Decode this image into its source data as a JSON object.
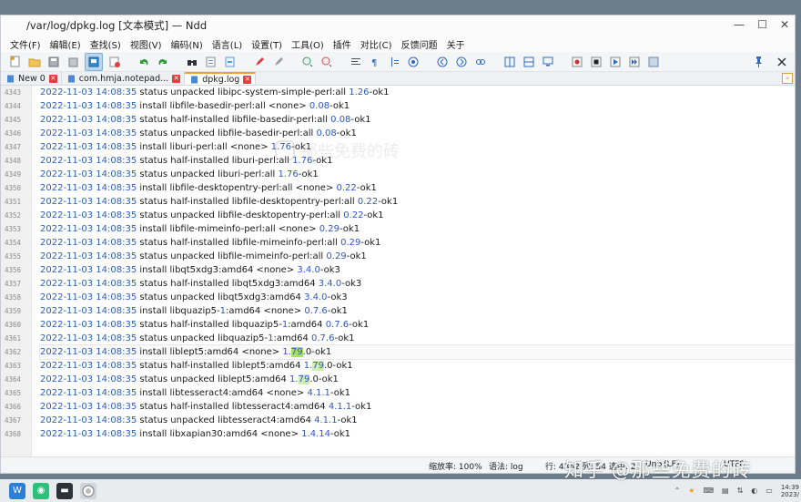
{
  "window": {
    "title": "/var/log/dpkg.log [文本模式] — Ndd",
    "controls": {
      "minimize": "—",
      "maximize": "☐",
      "close": "✕"
    }
  },
  "menu": [
    "文件(F)",
    "编辑(E)",
    "查找(S)",
    "视图(V)",
    "编码(N)",
    "语言(L)",
    "设置(T)",
    "工具(O)",
    "插件",
    "对比(C)",
    "反馈问题",
    "关于"
  ],
  "tabs": [
    {
      "label": "New 0",
      "active": false
    },
    {
      "label": "com.hmja.notepad...",
      "active": false
    },
    {
      "label": "dpkg.log",
      "active": true
    }
  ],
  "editor": {
    "lines": [
      {
        "n": "4343",
        "ts": "2022-11-03 14:08:35",
        "a": " status unpacked libipc-system-simple-perl:all ",
        "v": "1.26",
        "b": "-ok1"
      },
      {
        "n": "4344",
        "ts": "2022-11-03 14:08:35",
        "a": " install libfile-basedir-perl:all <none> ",
        "v": "0.08",
        "b": "-ok1"
      },
      {
        "n": "4345",
        "ts": "2022-11-03 14:08:35",
        "a": " status half-installed libfile-basedir-perl:all ",
        "v": "0.08",
        "b": "-ok1"
      },
      {
        "n": "4346",
        "ts": "2022-11-03 14:08:35",
        "a": " status unpacked libfile-basedir-perl:all ",
        "v": "0.08",
        "b": "-ok1"
      },
      {
        "n": "4347",
        "ts": "2022-11-03 14:08:35",
        "a": " install liburi-perl:all <none> ",
        "v": "1.76",
        "b": "-ok1"
      },
      {
        "n": "4348",
        "ts": "2022-11-03 14:08:35",
        "a": " status half-installed liburi-perl:all ",
        "v": "1.76",
        "b": "-ok1"
      },
      {
        "n": "4349",
        "ts": "2022-11-03 14:08:35",
        "a": " status unpacked liburi-perl:all ",
        "v": "1.76",
        "b": "-ok1"
      },
      {
        "n": "4350",
        "ts": "2022-11-03 14:08:35",
        "a": " install libfile-desktopentry-perl:all <none> ",
        "v": "0.22",
        "b": "-ok1"
      },
      {
        "n": "4351",
        "ts": "2022-11-03 14:08:35",
        "a": " status half-installed libfile-desktopentry-perl:all ",
        "v": "0.22",
        "b": "-ok1"
      },
      {
        "n": "4352",
        "ts": "2022-11-03 14:08:35",
        "a": " status unpacked libfile-desktopentry-perl:all ",
        "v": "0.22",
        "b": "-ok1"
      },
      {
        "n": "4353",
        "ts": "2022-11-03 14:08:35",
        "a": " install libfile-mimeinfo-perl:all <none> ",
        "v": "0.29",
        "b": "-ok1"
      },
      {
        "n": "4354",
        "ts": "2022-11-03 14:08:35",
        "a": " status half-installed libfile-mimeinfo-perl:all ",
        "v": "0.29",
        "b": "-ok1"
      },
      {
        "n": "4355",
        "ts": "2022-11-03 14:08:35",
        "a": " status unpacked libfile-mimeinfo-perl:all ",
        "v": "0.29",
        "b": "-ok1"
      },
      {
        "n": "4356",
        "ts": "2022-11-03 14:08:35",
        "a": " install libqt5xdg3:amd64 <none> ",
        "v": "3.4.0",
        "b": "-ok3"
      },
      {
        "n": "4357",
        "ts": "2022-11-03 14:08:35",
        "a": " status half-installed libqt5xdg3:amd64 ",
        "v": "3.4.0",
        "b": "-ok3"
      },
      {
        "n": "4358",
        "ts": "2022-11-03 14:08:35",
        "a": " status unpacked libqt5xdg3:amd64 ",
        "v": "3.4.0",
        "b": "-ok3"
      },
      {
        "n": "4359",
        "ts": "2022-11-03 14:08:35",
        "a": " install libquazip5-",
        "v": "1",
        "b": ":amd64 <none> ",
        "v2": "0.7.6",
        "c": "-ok1"
      },
      {
        "n": "4360",
        "ts": "2022-11-03 14:08:35",
        "a": " status half-installed libquazip5-",
        "v": "1",
        "b": ":amd64 ",
        "v2": "0.7.6",
        "c": "-ok1"
      },
      {
        "n": "4361",
        "ts": "2022-11-03 14:08:35",
        "a": " status unpacked libquazip5-",
        "v": "1",
        "b": ":amd64 ",
        "v2": "0.7.6",
        "c": "-ok1"
      },
      {
        "n": "4362",
        "ts": "2022-11-03 14:08:35",
        "a": " install liblept5:amd64 <none> ",
        "v": "1.",
        "h": "79",
        "b": ".0-ok1",
        "cur": true
      },
      {
        "n": "4363",
        "ts": "2022-11-03 14:08:35",
        "a": " status half-installed liblept5:amd64 ",
        "v": "1.",
        "h": "79",
        "b": ".0-ok1"
      },
      {
        "n": "4364",
        "ts": "2022-11-03 14:08:35",
        "a": " status unpacked liblept5:amd64 ",
        "v": "1.",
        "h": "79",
        "b": ".0-ok1"
      },
      {
        "n": "4365",
        "ts": "2022-11-03 14:08:35",
        "a": " install libtesseract4:amd64 <none> ",
        "v": "4.1.1",
        "b": "-ok1"
      },
      {
        "n": "4366",
        "ts": "2022-11-03 14:08:35",
        "a": " status half-installed libtesseract4:amd64 ",
        "v": "4.1.1",
        "b": "-ok1"
      },
      {
        "n": "4367",
        "ts": "2022-11-03 14:08:35",
        "a": " status unpacked libtesseract4:amd64 ",
        "v": "4.1.1",
        "b": "-ok1"
      },
      {
        "n": "4368",
        "ts": "2022-11-03 14:08:35",
        "a": " install libxapian30:amd64 <none> ",
        "v": "1.4.14",
        "b": "-ok1"
      }
    ],
    "watermark": "那些免费的砖"
  },
  "status": {
    "zoom": "缩放率: 100%",
    "syntax": "语法:  log",
    "position": "行: 4362  列: 54  选中: 2",
    "eol": "Unix(LF)",
    "encoding": "UTF8"
  },
  "taskbar": {
    "clock_time": "14:39",
    "clock_date": "2023/"
  },
  "overlay_watermark": "知乎 @那些免费的砖",
  "colors": {
    "timestamp": "#2b5fb8",
    "version": "#2f57c5",
    "match_highlight": "#a8e060",
    "tab_accent": "#f0a030"
  }
}
